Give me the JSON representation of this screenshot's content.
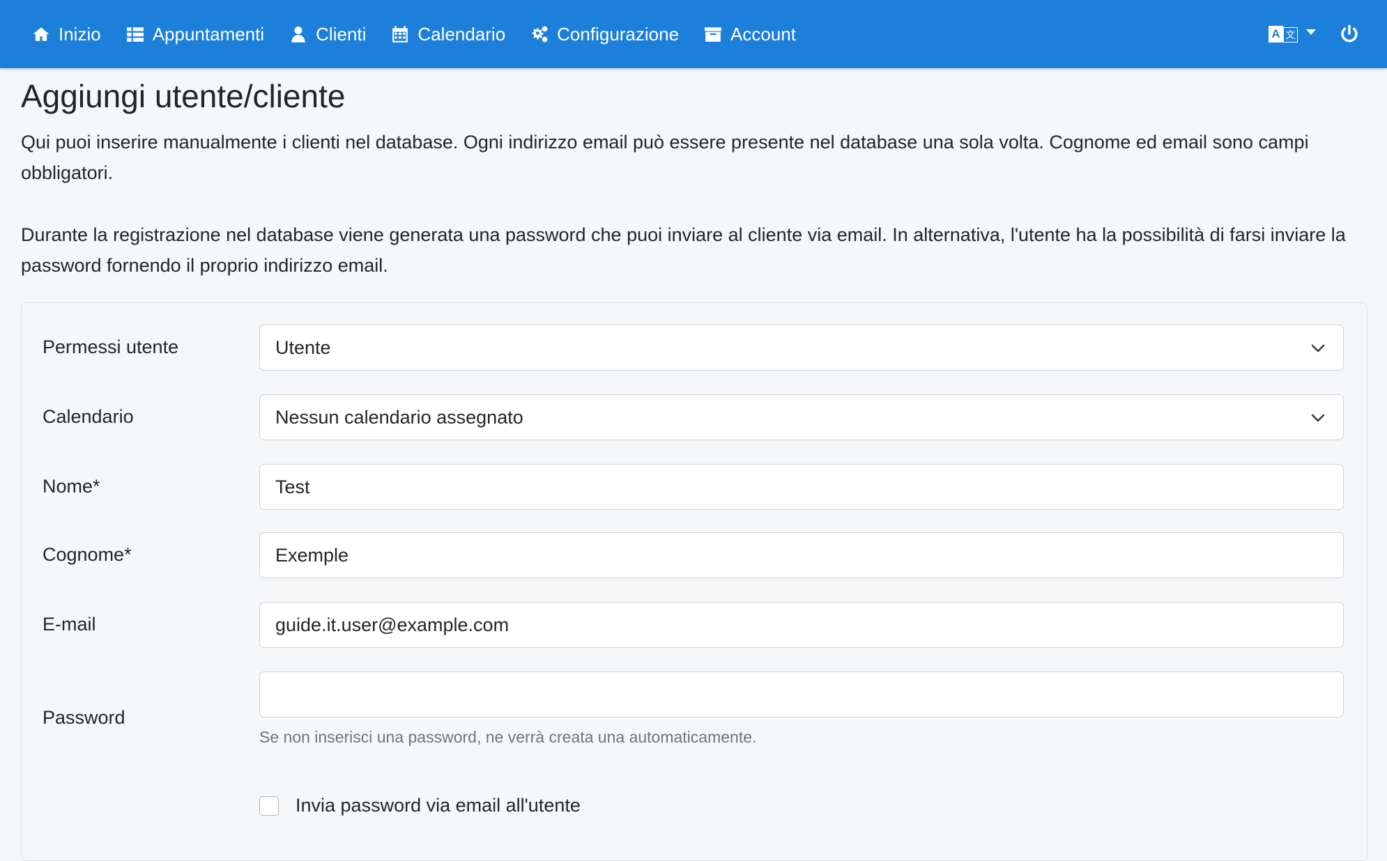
{
  "nav": {
    "items": [
      {
        "label": "Inizio",
        "icon": "home-icon"
      },
      {
        "label": "Appuntamenti",
        "icon": "list-icon"
      },
      {
        "label": "Clienti",
        "icon": "user-icon"
      },
      {
        "label": "Calendario",
        "icon": "calendar-icon"
      },
      {
        "label": "Configurazione",
        "icon": "gears-icon"
      },
      {
        "label": "Account",
        "icon": "archive-icon"
      }
    ],
    "language_icon": "language-icon",
    "logout_icon": "power-icon"
  },
  "page": {
    "title": "Aggiungi utente/cliente",
    "intro_1": "Qui puoi inserire manualmente i clienti nel database. Ogni indirizzo email può essere presente nel database una sola volta. Cognome ed email sono campi obbligatori.",
    "intro_2": "Durante la registrazione nel database viene generata una password che puoi inviare al cliente via email. In alternativa, l'utente ha la possibilità di farsi inviare la password fornendo il proprio indirizzo email."
  },
  "form": {
    "permissions": {
      "label": "Permessi utente",
      "value": "Utente"
    },
    "calendar": {
      "label": "Calendario",
      "value": "Nessun calendario assegnato"
    },
    "first_name": {
      "label": "Nome*",
      "value": "Test"
    },
    "last_name": {
      "label": "Cognome*",
      "value": "Exemple"
    },
    "email": {
      "label": "E-mail",
      "value": "guide.it.user@example.com"
    },
    "password": {
      "label": "Password",
      "value": "",
      "help": "Se non inserisci una password, ne verrà creata una automaticamente."
    },
    "send_password": {
      "label": "Invia password via email all'utente",
      "checked": false
    }
  },
  "colors": {
    "navbar": "#1c7fd9",
    "background": "#f6f7f9",
    "text": "#212529",
    "muted": "#6c757d"
  }
}
